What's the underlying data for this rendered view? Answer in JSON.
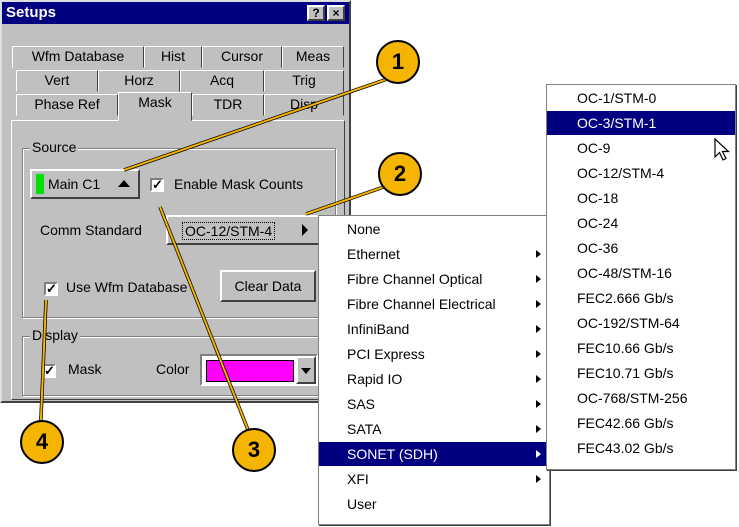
{
  "window": {
    "title": "Setups",
    "help_btn": "?",
    "close_btn": "×"
  },
  "tabs": {
    "row1": [
      "Wfm Database",
      "Hist",
      "Cursor",
      "Meas"
    ],
    "row2": [
      "Vert",
      "Horz",
      "Acq",
      "Trig"
    ],
    "row3": [
      "Phase Ref",
      "Mask",
      "TDR",
      "Disp"
    ],
    "active": "Mask"
  },
  "source": {
    "group_label": "Source",
    "source_button": "Main C1",
    "enable_mask_counts_label": "Enable Mask Counts",
    "enable_mask_counts_checked": true,
    "comm_standard_label": "Comm Standard",
    "comm_standard_value": "OC-12/STM-4",
    "use_wfm_database_label": "Use Wfm Database",
    "use_wfm_database_checked": true,
    "clear_data_label": "Clear Data"
  },
  "display": {
    "group_label": "Display",
    "mask_label": "Mask",
    "mask_checked": true,
    "color_label": "Color",
    "color_value": "#ff00ff"
  },
  "comm_menu": {
    "items": [
      {
        "label": "None",
        "submenu": false
      },
      {
        "label": "Ethernet",
        "submenu": true
      },
      {
        "label": "Fibre Channel Optical",
        "submenu": true
      },
      {
        "label": "Fibre Channel Electrical",
        "submenu": true
      },
      {
        "label": "InfiniBand",
        "submenu": true
      },
      {
        "label": "PCI Express",
        "submenu": true
      },
      {
        "label": "Rapid IO",
        "submenu": true
      },
      {
        "label": "SAS",
        "submenu": true
      },
      {
        "label": "SATA",
        "submenu": true
      },
      {
        "label": "SONET (SDH)",
        "submenu": true,
        "selected": true
      },
      {
        "label": "XFI",
        "submenu": true
      },
      {
        "label": "User",
        "submenu": false
      }
    ]
  },
  "sonet_menu": {
    "items": [
      {
        "label": "OC-1/STM-0"
      },
      {
        "label": "OC-3/STM-1",
        "selected": true
      },
      {
        "label": "OC-9"
      },
      {
        "label": "OC-12/STM-4"
      },
      {
        "label": "OC-18"
      },
      {
        "label": "OC-24"
      },
      {
        "label": "OC-36"
      },
      {
        "label": "OC-48/STM-16"
      },
      {
        "label": "FEC2.666 Gb/s"
      },
      {
        "label": "OC-192/STM-64"
      },
      {
        "label": "FEC10.66 Gb/s"
      },
      {
        "label": "FEC10.71 Gb/s"
      },
      {
        "label": "OC-768/STM-256"
      },
      {
        "label": "FEC42.66 Gb/s"
      },
      {
        "label": "FEC43.02 Gb/s"
      }
    ]
  },
  "callouts": [
    "1",
    "2",
    "3",
    "4"
  ],
  "colors": {
    "selection": "#000080",
    "callout": "#f5b400",
    "source_indicator": "#00e000"
  }
}
